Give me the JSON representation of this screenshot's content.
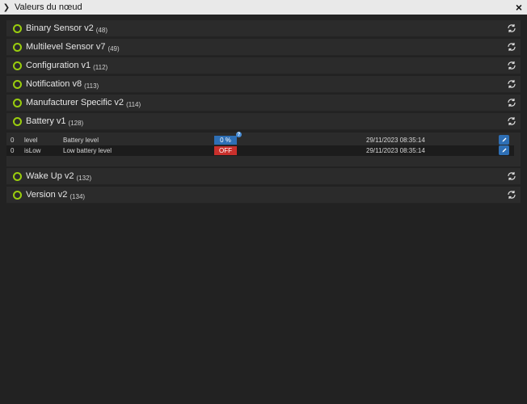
{
  "window": {
    "title": "Valeurs du nœud",
    "close_glyph": "×"
  },
  "command_classes": [
    {
      "name": "Binary Sensor v2",
      "id": "(48)"
    },
    {
      "name": "Multilevel Sensor v7",
      "id": "(49)"
    },
    {
      "name": "Configuration v1",
      "id": "(112)"
    },
    {
      "name": "Notification v8",
      "id": "(113)"
    },
    {
      "name": "Manufacturer Specific v2",
      "id": "(114)"
    },
    {
      "name": "Battery v1",
      "id": "(128)"
    },
    {
      "name": "Wake Up v2",
      "id": "(132)"
    },
    {
      "name": "Version v2",
      "id": "(134)"
    }
  ],
  "battery_values": [
    {
      "instance": "0",
      "key": "level",
      "label": "Battery level",
      "value": "0 %",
      "date": "29/11/2023 08:35:14"
    },
    {
      "instance": "0",
      "key": "isLow",
      "label": "Low battery level",
      "value": "OFF",
      "date": "29/11/2023 08:35:14"
    }
  ],
  "help_glyph": "?",
  "colors": {
    "status_ring": "#9acd0e",
    "value_blue": "#2e6fb5",
    "value_red": "#c9302c"
  }
}
